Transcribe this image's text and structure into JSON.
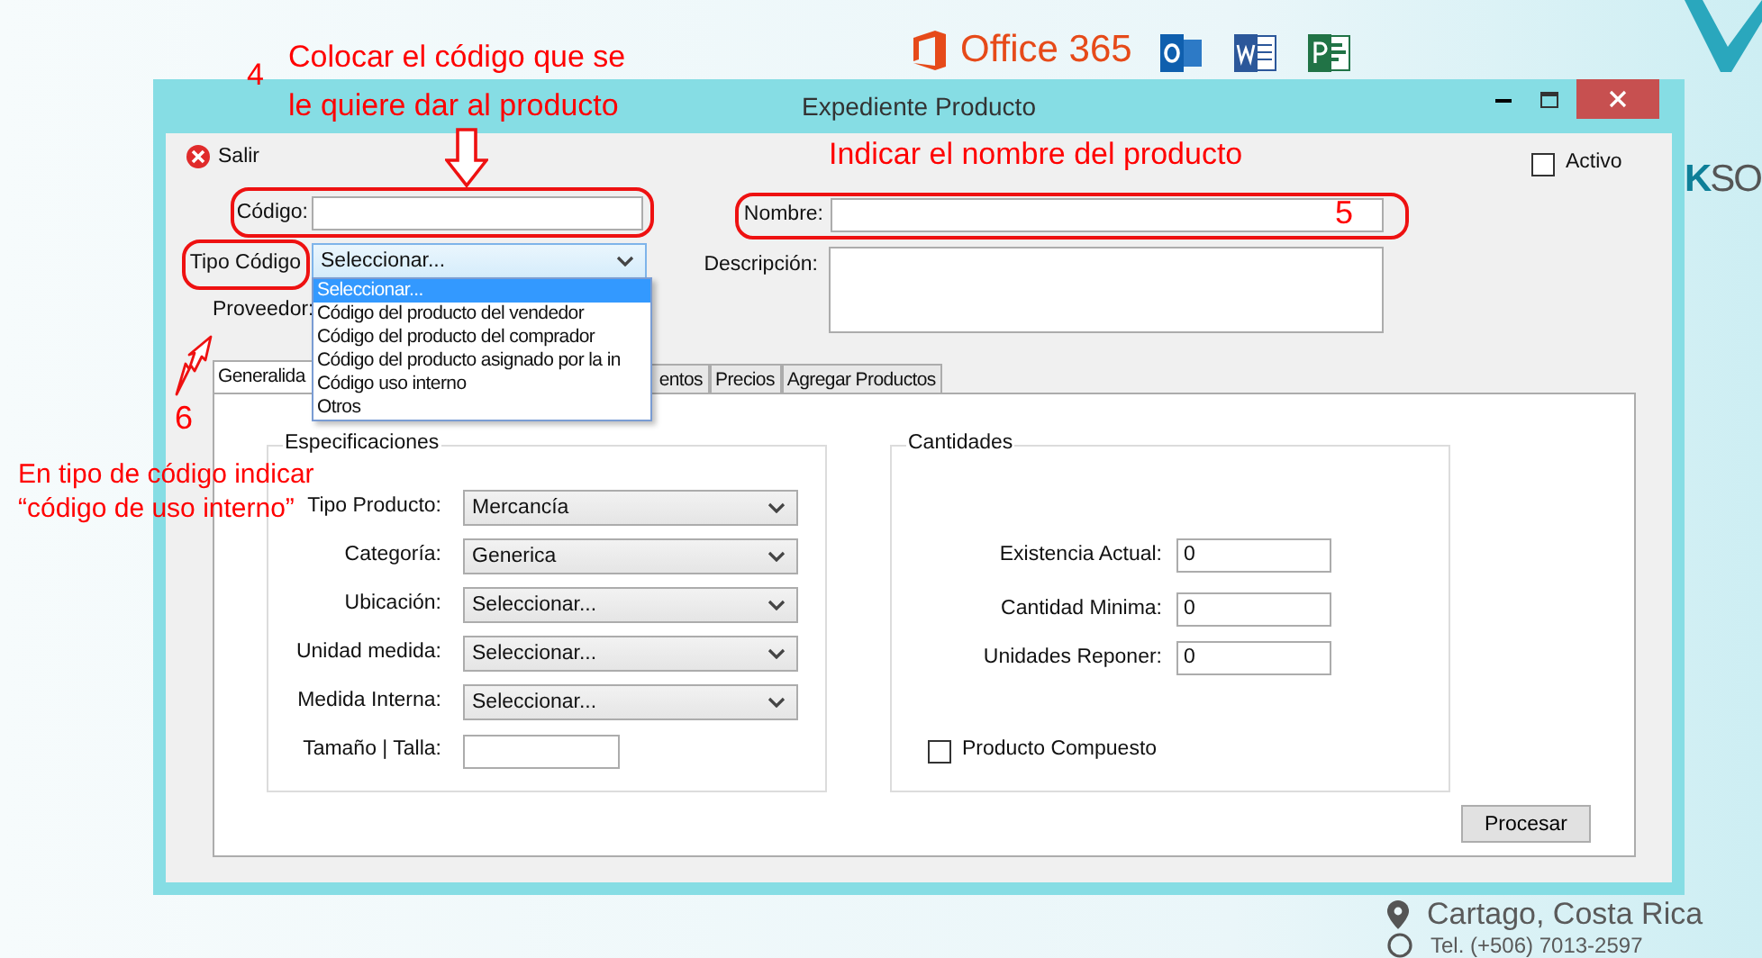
{
  "background": {
    "office_logo_text": "Office 365",
    "brand_fragments": [
      "K",
      "SO"
    ],
    "contact": [
      "Cartago, Costa Rica",
      "Tel. (+506) 7013-2597"
    ]
  },
  "window": {
    "title": "Expediente Producto"
  },
  "toolbar": {
    "exit_button": "Salir",
    "active_checkbox": {
      "label": "Activo",
      "checked": false
    }
  },
  "form": {
    "code": {
      "label": "Código:"
    },
    "code_type": {
      "label": "Tipo Código",
      "value": "Seleccionar...",
      "expanded": true,
      "options": [
        {
          "label": "Seleccionar...",
          "selected": true
        },
        {
          "label": "Código del producto del vendedor",
          "selected": false
        },
        {
          "label": "Código del producto del comprador",
          "selected": false
        },
        {
          "label": "Código del producto asignado por la in",
          "selected": false
        },
        {
          "label": "Código uso interno",
          "selected": false
        },
        {
          "label": "Otros",
          "selected": false
        }
      ]
    },
    "supplier": {
      "label": "Proveedor:"
    },
    "name": {
      "label": "Nombre:"
    },
    "description": {
      "label": "Descripción:"
    }
  },
  "tabs": [
    {
      "label": "Generalida",
      "selected": true
    },
    {
      "label": "entos",
      "selected": false
    },
    {
      "label": "Precios",
      "selected": false
    },
    {
      "label": "Agregar Productos",
      "selected": false
    }
  ],
  "specifications": {
    "title": "Especificaciones",
    "rows": [
      {
        "label": "Tipo Producto:",
        "kind": "select",
        "value": "Mercancía"
      },
      {
        "label": "Categoría:",
        "kind": "select",
        "value": "Generica"
      },
      {
        "label": "Ubicación:",
        "kind": "select",
        "value": "Seleccionar..."
      },
      {
        "label": "Unidad medida:",
        "kind": "select",
        "value": "Seleccionar..."
      },
      {
        "label": "Medida Interna:",
        "kind": "select",
        "value": "Seleccionar..."
      },
      {
        "label": "Tamaño | Talla:",
        "kind": "text"
      }
    ]
  },
  "quantities": {
    "title": "Cantidades",
    "rows": [
      {
        "label": "Existencia Actual:",
        "value": "0"
      },
      {
        "label": "Cantidad Minima:",
        "value": "0"
      },
      {
        "label": "Unidades Reponer:",
        "value": "0"
      }
    ],
    "composite": {
      "label": "Producto Compuesto",
      "checked": false
    }
  },
  "process_button": "Procesar",
  "annotations": [
    {
      "number": "4",
      "lines": [
        "Colocar el código que se",
        "le quiere dar al producto"
      ]
    },
    {
      "number": "5",
      "lines": [
        "Indicar el nombre del producto"
      ]
    },
    {
      "number": "6",
      "lines": [
        "En tipo de código indicar",
        "“código de uso interno”"
      ]
    }
  ]
}
